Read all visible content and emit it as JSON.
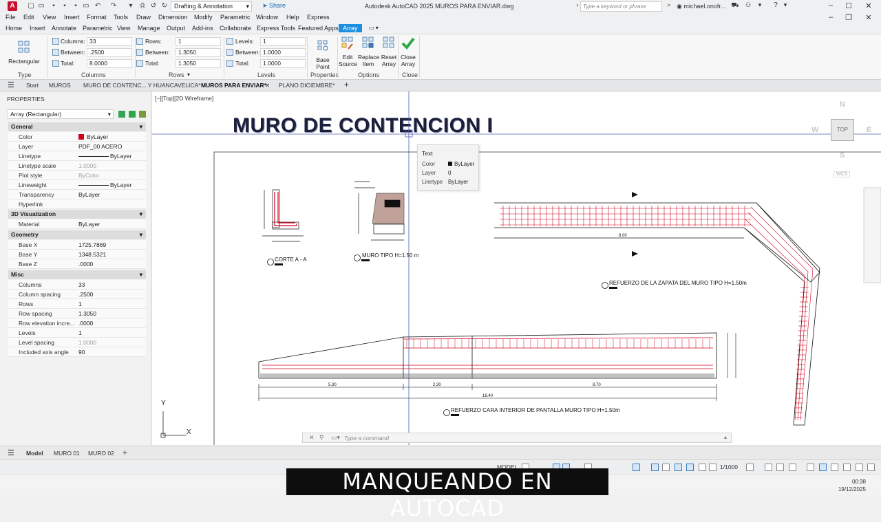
{
  "titlebar": {
    "app_logo": "A",
    "workspace": "Drafting & Annotation",
    "share": "Share",
    "title": "Autodesk AutoCAD 2025    MUROS PARA ENVIAR.dwg",
    "search_placeholder": "Type a keyword or phrase",
    "user": "michael.onofr..."
  },
  "menu": [
    "File",
    "Edit",
    "View",
    "Insert",
    "Format",
    "Tools",
    "Draw",
    "Dimension",
    "Modify",
    "Parametric",
    "Window",
    "Help",
    "Express"
  ],
  "ribbon_tabs": [
    "Home",
    "Insert",
    "Annotate",
    "Parametric",
    "View",
    "Manage",
    "Output",
    "Add-ins",
    "Collaborate",
    "Express Tools",
    "Featured Apps",
    "Array"
  ],
  "ribbon": {
    "type": {
      "button": "Rectangular",
      "label": "Type"
    },
    "columns": {
      "label": "Columns",
      "columns_label": "Columns:",
      "columns_value": "33",
      "between_label": "Between:",
      "between_value": ".2500",
      "total_label": "Total:",
      "total_value": "8.0000"
    },
    "rows": {
      "label": "Rows",
      "rows_label": "Rows:",
      "rows_value": "1",
      "between_label": "Between:",
      "between_value": "1.3050",
      "total_label": "Total:",
      "total_value": "1.3050"
    },
    "levels": {
      "label": "Levels",
      "levels_label": "Levels:",
      "levels_value": "1",
      "between_label": "Between:",
      "between_value": "1.0000",
      "total_label": "Total:",
      "total_value": "1.0000"
    },
    "properties": {
      "label": "Properties",
      "base_point": "Base Point"
    },
    "options": {
      "label": "Options",
      "edit_source": "Edit Source",
      "replace_item": "Replace Item",
      "reset_array": "Reset Array"
    },
    "close": {
      "label": "Close",
      "close_array": "Close Array"
    }
  },
  "doc_tabs": [
    "Start",
    "MUROS",
    "MURO DE CONTENC... Y HUANCAVELICA*",
    "MUROS PARA ENVIAR*",
    "PLANO DICIEMBRE*"
  ],
  "properties": {
    "title": "PROPERTIES",
    "selection": "Array (Rectangular)",
    "sections": {
      "general": "General",
      "viz3d": "3D Visualization",
      "geometry": "Geometry",
      "misc": "Misc"
    },
    "general": [
      {
        "k": "Color",
        "v": "ByLayer"
      },
      {
        "k": "Layer",
        "v": "PDF_00 ACERO"
      },
      {
        "k": "Linetype",
        "v": "ByLayer"
      },
      {
        "k": "Linetype scale",
        "v": "1.0000"
      },
      {
        "k": "Plot style",
        "v": "ByColor"
      },
      {
        "k": "Lineweight",
        "v": "ByLayer"
      },
      {
        "k": "Transparency",
        "v": "ByLayer"
      },
      {
        "k": "Hyperlink",
        "v": ""
      }
    ],
    "viz3d": [
      {
        "k": "Material",
        "v": "ByLayer"
      }
    ],
    "geometry": [
      {
        "k": "Base X",
        "v": "1725.7869"
      },
      {
        "k": "Base Y",
        "v": "1348.5321"
      },
      {
        "k": "Base Z",
        "v": ".0000"
      }
    ],
    "misc": [
      {
        "k": "Columns",
        "v": "33"
      },
      {
        "k": "Column spacing",
        "v": ".2500"
      },
      {
        "k": "Rows",
        "v": "1"
      },
      {
        "k": "Row spacing",
        "v": "1.3050"
      },
      {
        "k": "Row elevation incre...",
        "v": ".0000"
      },
      {
        "k": "Levels",
        "v": "1"
      },
      {
        "k": "Level spacing",
        "v": "1.0000"
      },
      {
        "k": "Included axis angle",
        "v": "90"
      }
    ]
  },
  "canvas": {
    "viewport_label": "[−][Top][2D Wireframe]",
    "big_title": "MURO DE CONTENCION I",
    "labels": {
      "corte": "CORTE A - A",
      "muro_tipo": "MURO TIPO H=1.50 m",
      "refuerzo_zapata": "REFUERZO DE LA ZAPATA DEL MURO TIPO H=1.50m",
      "refuerzo_pantalla": "REFUERZO CARA INTERIOR DE PANTALLA MURO TIPO H=1.50m",
      "dim_530": "5.30",
      "dim_230": "2.30",
      "dim_870": "8.70",
      "dim_1640": "16.40",
      "dim_600": "6.00"
    },
    "tooltip": {
      "title": "Text",
      "color_k": "Color",
      "color_v": "ByLayer",
      "layer_k": "Layer",
      "layer_v": "0",
      "linetype_k": "Linetype",
      "linetype_v": "ByLayer"
    },
    "viewcube": {
      "n": "N",
      "w": "W",
      "e": "E",
      "s": "S",
      "top": "TOP",
      "wcs": "WCS"
    },
    "ucs_x": "X",
    "ucs_y": "Y",
    "command_placeholder": "Type a command"
  },
  "layout_tabs": [
    "Model",
    "MURO 01",
    "MURO 02"
  ],
  "status": {
    "model": "MODEL",
    "scale": "1/1000"
  },
  "taskbar": {
    "time": "00:38",
    "date": "19/12/2025"
  },
  "banner": "MANQUEANDO EN AUTOCAD",
  "colors": {
    "accent": "#1b8fe0",
    "rebar": "#d0021b",
    "title_dark": "#1a1f3b"
  }
}
